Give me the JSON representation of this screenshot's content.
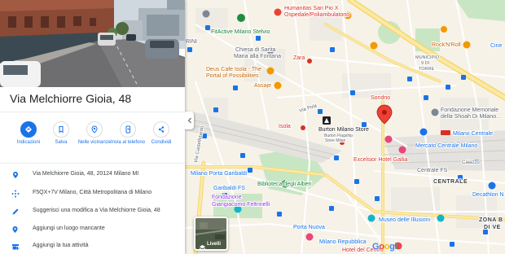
{
  "panel": {
    "title": "Via Melchiorre Gioia, 48",
    "actions": [
      {
        "label": "Indicazioni",
        "icon": "directions-icon"
      },
      {
        "label": "Salva",
        "icon": "bookmark-icon"
      },
      {
        "label": "Nelle vicinanze",
        "icon": "nearby-icon"
      },
      {
        "label": "Invia al telefono",
        "icon": "send-to-phone-icon"
      },
      {
        "label": "Condividi",
        "icon": "share-icon"
      }
    ],
    "info_rows": [
      {
        "icon": "location-pin-icon",
        "text": "Via Melchiorre Gioia, 48, 20124 Milano MI"
      },
      {
        "icon": "plus-code-icon",
        "text": "F5QX+7V Milano, Città Metropolitana di Milano"
      },
      {
        "icon": "pencil-icon",
        "text": "Suggerisci una modifica a Via Melchiorre Gioia, 48"
      },
      {
        "icon": "add-place-icon",
        "text": "Aggiungi un luogo mancante"
      },
      {
        "icon": "business-icon",
        "text": "Aggiungi la tua attività"
      }
    ]
  },
  "map": {
    "layers_label": "Livelli",
    "google_logo": [
      "G",
      "o",
      "o",
      "g",
      "l",
      "e"
    ],
    "google_colors": [
      "#4285f4",
      "#ea4335",
      "#fbbc05",
      "#4285f4",
      "#34a853",
      "#ea4335"
    ],
    "labels": {
      "factive": "FitActive Milano Stelvio",
      "humanitas1": "Humanitas San Pio X",
      "humanitas2": "Ospedale/Poliambulatorio",
      "rocknroll": "Rock'N'Roll",
      "municipio1": "MUNICIPIO",
      "municipio2": "9 DI",
      "municipio3": "TORRE",
      "cine": "Cine",
      "rini": "RINI",
      "chiesa1": "Chiesa di Santa",
      "chiesa2": "Maria alla Fontana",
      "zara": "Zara",
      "deus1": "Deus Cafe Isola - The",
      "deus2": "Portal of Possibilities",
      "assaje": "Assaje",
      "sondrio": "Sondrio",
      "viapola": "Via Pola",
      "burton1": "Burton Milano Store",
      "burton2": "Burton Flagship",
      "burton3": "Store Milan",
      "fondshoah1": "Fondazione Memoriale",
      "fondshoah2": "della Shoah Di Milano...",
      "milanocentrale_top": "Milano Centrale",
      "isola": "Isola",
      "viacastelfidardo": "Via Castelfidardo",
      "mercato": "Mercato Centrale Milano",
      "caiazzo": "Caiazzo",
      "excelsior": "Excelsior Hotel Gallia",
      "centrale_fs": "Centrale FS",
      "centrale": "CENTRALE",
      "garibaldi_station": "Milano Porta Garibaldi",
      "garibaldi_fs": "Garibaldi FS",
      "biblioteca": "Biblioteca degli Alberi",
      "fondgiang1": "Fondazione",
      "fondgiang2": "Giangiacomo Feltrinelli",
      "decathlon": "Decathlon N",
      "portanuova": "Porta Nuova",
      "museo": "Museo delle Illusioni",
      "zonab1": "ZONA B",
      "zonab2": "DI VE",
      "repubblica": "Milano Repubblica",
      "hotel_centro": "Hotel del Centro"
    }
  }
}
